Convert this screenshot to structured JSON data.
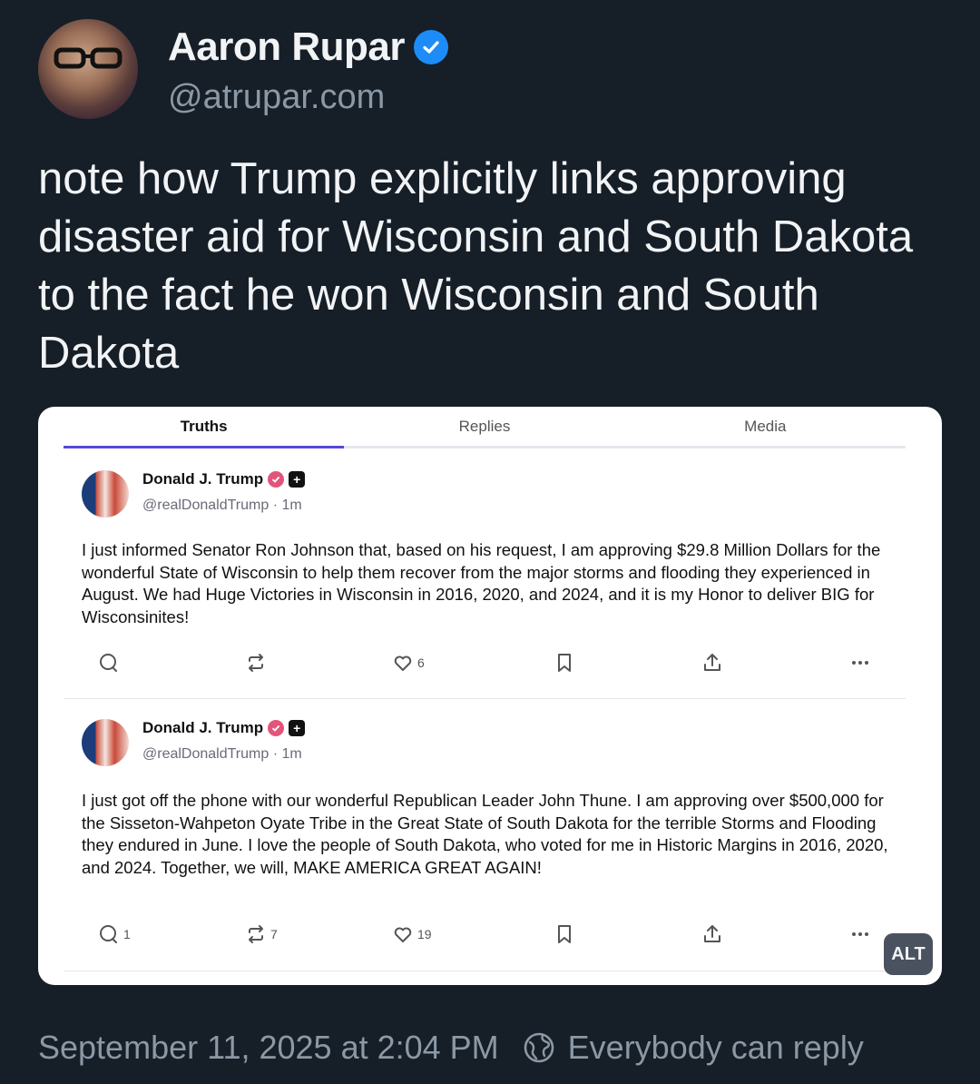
{
  "author": {
    "name": "Aaron Rupar",
    "handle": "@atrupar.com",
    "verified_color": "#1d8cf8"
  },
  "post": {
    "text": "note how Trump explicitly links approving disaster aid for Wisconsin and South Dakota to the fact he won Wisconsin and South Dakota"
  },
  "embed": {
    "tabs": [
      {
        "label": "Truths",
        "active": true
      },
      {
        "label": "Replies",
        "active": false
      },
      {
        "label": "Media",
        "active": false
      }
    ],
    "truths": [
      {
        "name": "Donald J. Trump",
        "handle": "@realDonaldTrump · 1m",
        "text": "I just informed Senator Ron Johnson that, based on his request, I am approving $29.8 Million Dollars for the wonderful State of Wisconsin to help them recover from the major storms and flooding they experienced in August. We had Huge Victories in Wisconsin in 2016, 2020, and 2024, and it is my Honor to deliver BIG for Wisconsinites!",
        "replies": "",
        "retruths": "",
        "likes": "6"
      },
      {
        "name": "Donald J. Trump",
        "handle": "@realDonaldTrump · 1m",
        "text": "I just got off the phone with our wonderful Republican Leader John Thune. I am approving over $500,000 for the Sisseton-Wahpeton Oyate Tribe in the Great State of South Dakota for the terrible Storms and Flooding they endured in June. I love the people of South Dakota, who voted for me in Historic Margins in 2016, 2020, and 2024. Together, we will, MAKE AMERICA GREAT AGAIN!",
        "replies": "1",
        "retruths": "7",
        "likes": "19"
      }
    ],
    "alt_label": "ALT"
  },
  "footer": {
    "timestamp": "September 11, 2025 at 2:04 PM",
    "reply_setting": "Everybody can reply"
  },
  "icons": [
    "verified-icon",
    "reply-icon",
    "retruth-icon",
    "like-icon",
    "bookmark-icon",
    "share-icon",
    "more-icon",
    "globe-icon"
  ]
}
